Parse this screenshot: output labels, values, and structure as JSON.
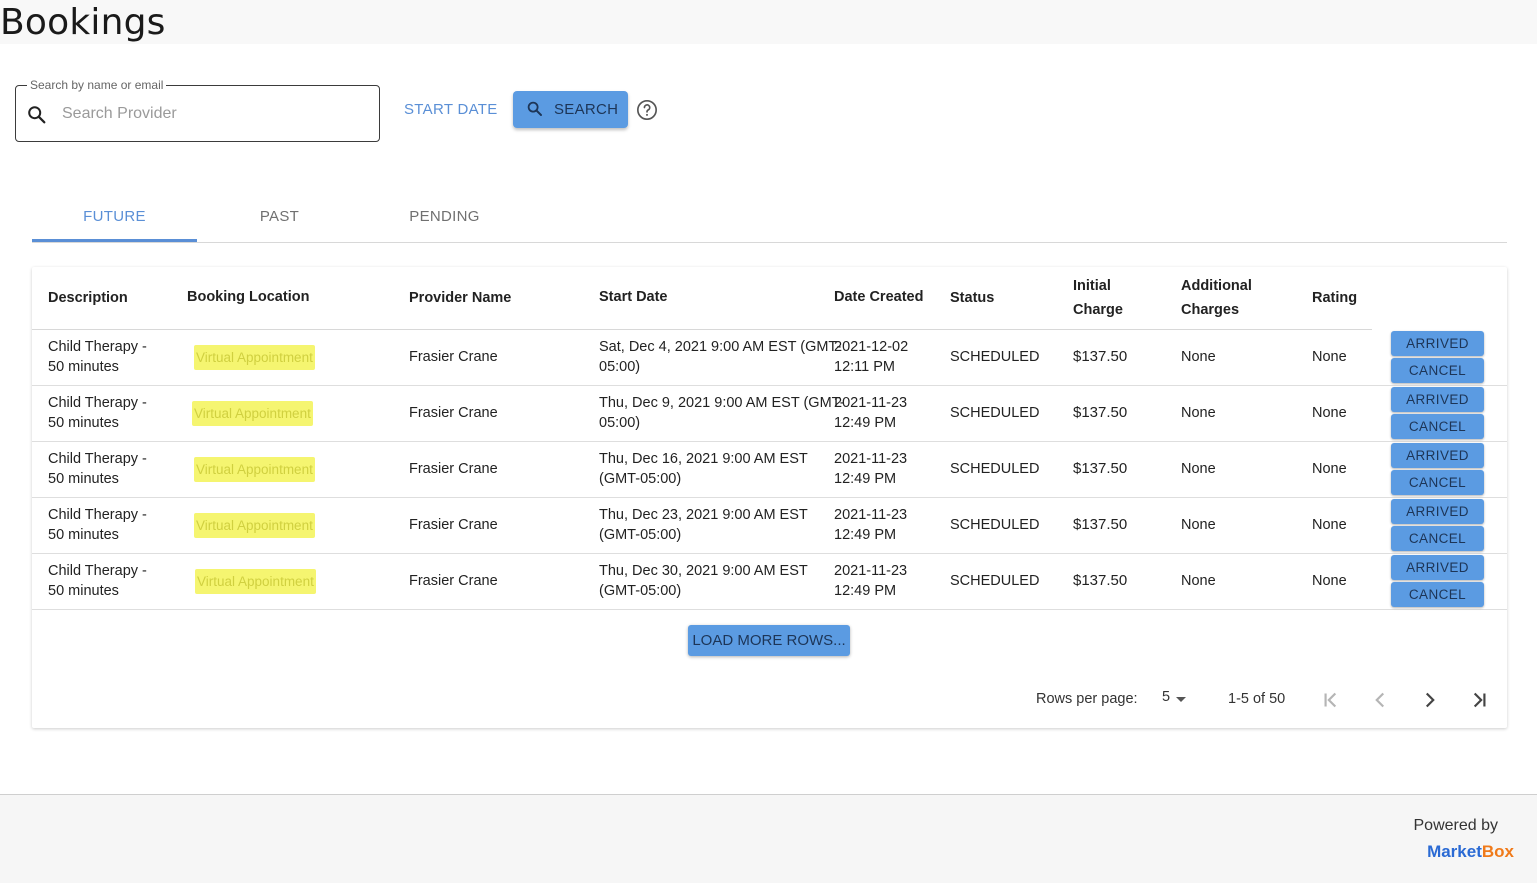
{
  "page": {
    "title": "Bookings"
  },
  "search": {
    "legend": "Search by name or email",
    "placeholder": "Search Provider",
    "start_date_label": "START DATE",
    "button_label": "SEARCH"
  },
  "tabs": [
    {
      "label": "FUTURE",
      "active": true
    },
    {
      "label": "PAST",
      "active": false
    },
    {
      "label": "PENDING",
      "active": false
    }
  ],
  "table": {
    "columns": {
      "description": "Description",
      "location": "Booking Location",
      "provider": "Provider Name",
      "start_date": "Start Date",
      "date_created": "Date Created",
      "status": "Status",
      "initial_charge_1": "Initial",
      "initial_charge_2": "Charge",
      "additional_charges_1": "Additional",
      "additional_charges_2": "Charges",
      "rating": "Rating"
    },
    "rows": [
      {
        "desc1": "Child Therapy -",
        "desc2": "50 minutes",
        "location": "Virtual Appointment",
        "provider": "Frasier Crane",
        "start1": "Sat, Dec 4, 2021 9:00 AM EST (GMT-",
        "start2": "05:00)",
        "created1": "2021-12-02",
        "created2": "12:11 PM",
        "status": "SCHEDULED",
        "initial": "$137.50",
        "additional": "None",
        "rating": "None",
        "arrived": "ARRIVED",
        "cancel": "CANCEL"
      },
      {
        "desc1": "Child Therapy -",
        "desc2": "50 minutes",
        "location": "Virtual Appointment",
        "provider": "Frasier Crane",
        "start1": "Thu, Dec 9, 2021 9:00 AM EST (GMT-",
        "start2": "05:00)",
        "created1": "2021-11-23",
        "created2": "12:49 PM",
        "status": "SCHEDULED",
        "initial": "$137.50",
        "additional": "None",
        "rating": "None",
        "arrived": "ARRIVED",
        "cancel": "CANCEL"
      },
      {
        "desc1": "Child Therapy -",
        "desc2": "50 minutes",
        "location": "Virtual Appointment",
        "provider": "Frasier Crane",
        "start1": "Thu, Dec 16, 2021 9:00 AM EST",
        "start2": "(GMT-05:00)",
        "created1": "2021-11-23",
        "created2": "12:49 PM",
        "status": "SCHEDULED",
        "initial": "$137.50",
        "additional": "None",
        "rating": "None",
        "arrived": "ARRIVED",
        "cancel": "CANCEL"
      },
      {
        "desc1": "Child Therapy -",
        "desc2": "50 minutes",
        "location": "Virtual Appointment",
        "provider": "Frasier Crane",
        "start1": "Thu, Dec 23, 2021 9:00 AM EST",
        "start2": "(GMT-05:00)",
        "created1": "2021-11-23",
        "created2": "12:49 PM",
        "status": "SCHEDULED",
        "initial": "$137.50",
        "additional": "None",
        "rating": "None",
        "arrived": "ARRIVED",
        "cancel": "CANCEL"
      },
      {
        "desc1": "Child Therapy -",
        "desc2": "50 minutes",
        "location": "Virtual Appointment",
        "provider": "Frasier Crane",
        "start1": "Thu, Dec 30, 2021 9:00 AM EST",
        "start2": "(GMT-05:00)",
        "created1": "2021-11-23",
        "created2": "12:49 PM",
        "status": "SCHEDULED",
        "initial": "$137.50",
        "additional": "None",
        "rating": "None",
        "arrived": "ARRIVED",
        "cancel": "CANCEL"
      }
    ],
    "load_more_label": "LOAD MORE ROWS..."
  },
  "pagination": {
    "rows_per_page_label": "Rows per page:",
    "rows_per_page_value": "5",
    "range": "1-5 of 50"
  },
  "footer": {
    "powered_by": "Powered by",
    "brand_part1": "Market",
    "brand_part2": "Box"
  },
  "colors": {
    "accent": "#5a8fd6",
    "button": "#5b9be2",
    "highlight": "#f5f570"
  },
  "icons": [
    "search-icon",
    "help-circle-icon",
    "first-page-icon",
    "chevron-left-icon",
    "chevron-right-icon",
    "last-page-icon"
  ]
}
